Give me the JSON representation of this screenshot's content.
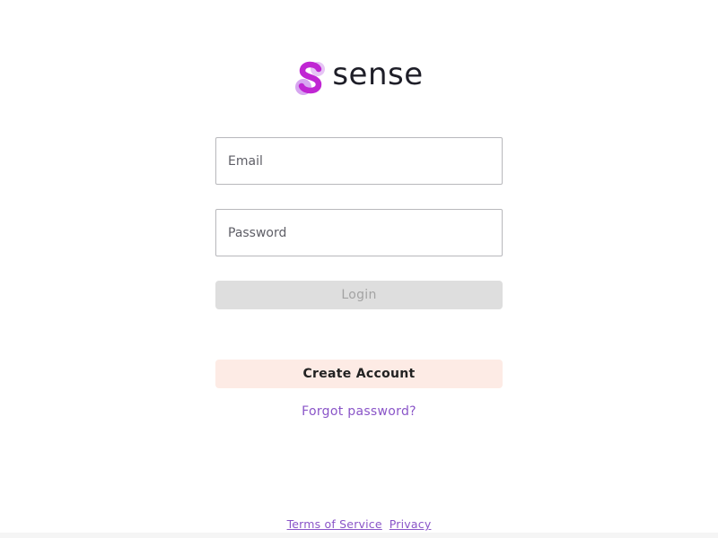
{
  "brand": {
    "name": "sense",
    "logo_icon": "sense-s-logo-icon",
    "colors": {
      "accent_purple": "#8a55c8",
      "logo_magenta": "#c026d3",
      "logo_lavender": "#d7a6f0"
    }
  },
  "login_form": {
    "email_placeholder": "Email",
    "password_placeholder": "Password",
    "login_label": "Login"
  },
  "actions": {
    "create_account_label": "Create Account",
    "forgot_password_label": "Forgot password?"
  },
  "footer": {
    "terms_label": "Terms of Service",
    "privacy_label": "Privacy"
  }
}
